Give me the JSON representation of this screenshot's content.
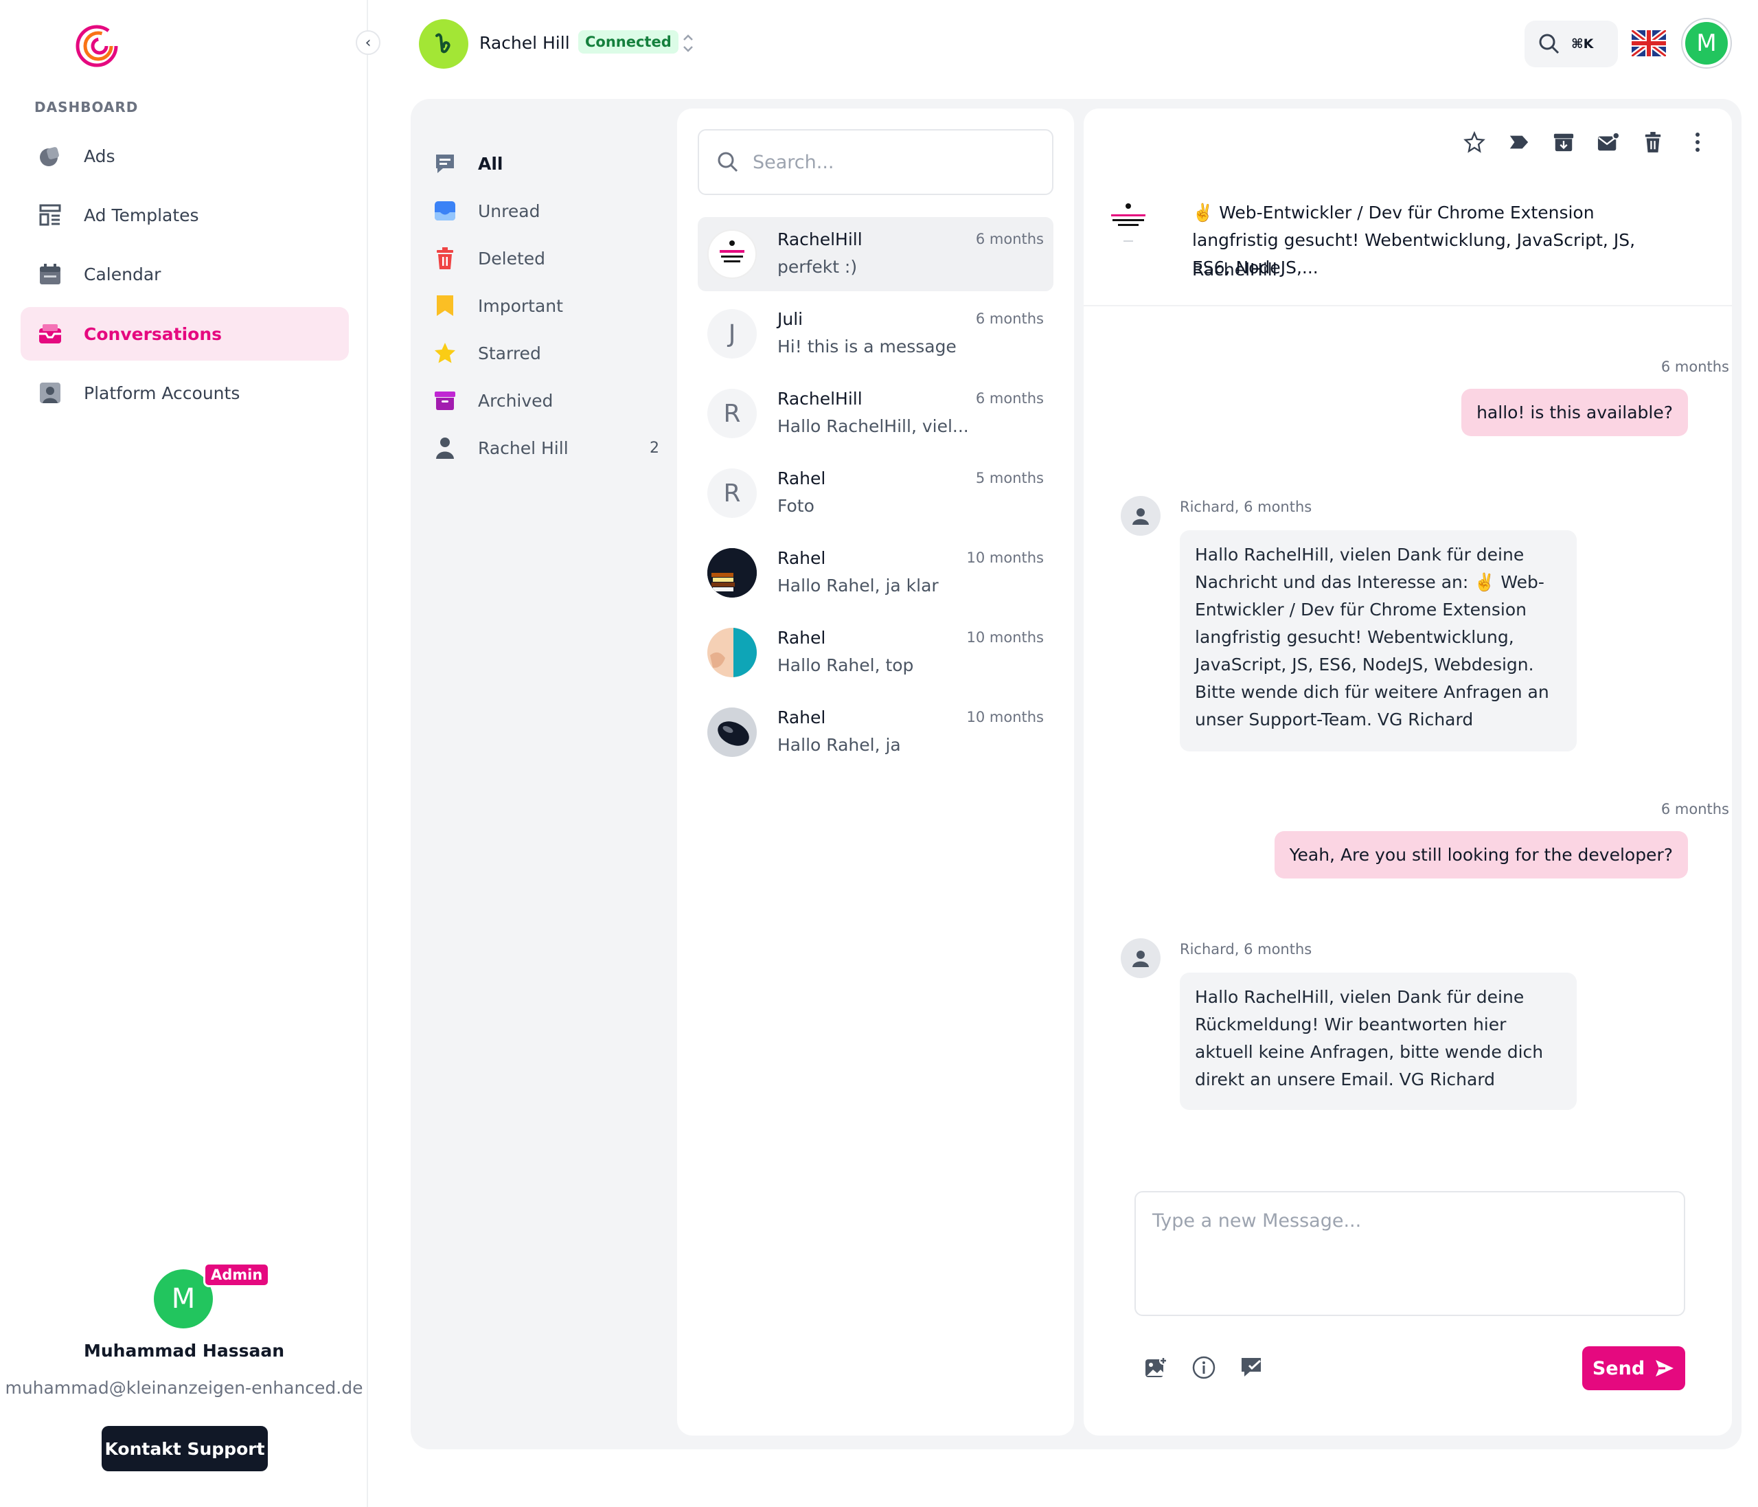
{
  "colors": {
    "accent": "#e5097f",
    "connected": "#15803d",
    "sidebar_active_bg": "#fce7f1",
    "outgoing_bubble": "#fbd5e3"
  },
  "sidebar": {
    "heading": "DASHBOARD",
    "items": [
      {
        "label": "Ads",
        "icon": "ads-icon"
      },
      {
        "label": "Ad Templates",
        "icon": "templates-icon"
      },
      {
        "label": "Calendar",
        "icon": "calendar-icon"
      },
      {
        "label": "Conversations",
        "icon": "inbox-icon",
        "active": true
      },
      {
        "label": "Platform Accounts",
        "icon": "account-icon"
      }
    ],
    "profile": {
      "initial": "M",
      "badge": "Admin",
      "name": "Muhammad Hassaan",
      "email": "muhammad@kleinanzeigen-enhanced.de"
    },
    "support_button": "Kontakt Support"
  },
  "topbar": {
    "account_name": "Rachel Hill",
    "status": "Connected",
    "shortcut": "⌘K",
    "user_initial": "M"
  },
  "folders": [
    {
      "label": "All",
      "icon": "chat-icon",
      "active": true
    },
    {
      "label": "Unread",
      "icon": "unread-icon"
    },
    {
      "label": "Deleted",
      "icon": "trash-icon"
    },
    {
      "label": "Important",
      "icon": "bookmark-icon"
    },
    {
      "label": "Starred",
      "icon": "star-icon"
    },
    {
      "label": "Archived",
      "icon": "archive-icon"
    },
    {
      "label": "Rachel Hill",
      "icon": "person-icon",
      "count": "2"
    }
  ],
  "search": {
    "placeholder": "Search..."
  },
  "conversations": [
    {
      "name": "RachelHill",
      "time": "6 months",
      "preview": "perfekt :)",
      "avatar": "ad-image",
      "active": true
    },
    {
      "name": "Juli",
      "time": "6 months",
      "preview": "Hi! this is a message",
      "avatar": "J"
    },
    {
      "name": "RachelHill",
      "time": "6 months",
      "preview": "Hallo RachelHill, viel...",
      "avatar": "R"
    },
    {
      "name": "Rahel",
      "time": "5 months",
      "preview": "Foto",
      "avatar": "R"
    },
    {
      "name": "Rahel",
      "time": "10 months",
      "preview": "Hallo Rahel, ja klar",
      "avatar": "books-photo"
    },
    {
      "name": "Rahel",
      "time": "10 months",
      "preview": "Hallo Rahel, top",
      "avatar": "teal-photo"
    },
    {
      "name": "Rahel",
      "time": "10 months",
      "preview": "Hallo Rahel, ja",
      "avatar": "mouse-photo"
    }
  ],
  "chat": {
    "ad_title": "✌️ Web-Entwickler / Dev für Chrome Extension langfristig gesucht! Webentwicklung, JavaScript, JS, ES6, NodeJS,...",
    "ad_user": "RachelHill",
    "messages": [
      {
        "dir": "out",
        "meta": "6 months",
        "text": "hallo! is this available?"
      },
      {
        "dir": "in",
        "meta": "Richard, 6 months",
        "text": "Hallo RachelHill, vielen Dank für deine Nachricht und das Interesse an: ✌️ Web-Entwickler / Dev für Chrome Extension langfristig gesucht! Webentwicklung, JavaScript, JS, ES6, NodeJS, Webdesign. Bitte wende dich für weitere Anfragen an unser Support-Team. VG Richard"
      },
      {
        "dir": "out",
        "meta": "6 months",
        "text": "Yeah, Are you still looking for the developer?"
      },
      {
        "dir": "in",
        "meta": "Richard, 6 months",
        "text": "Hallo RachelHill, vielen Dank für deine Rückmeldung! Wir beantworten hier aktuell keine Anfragen, bitte wende dich direkt an unsere Email. VG Richard"
      }
    ],
    "composer_placeholder": "Type a new Message...",
    "send_label": "Send"
  }
}
